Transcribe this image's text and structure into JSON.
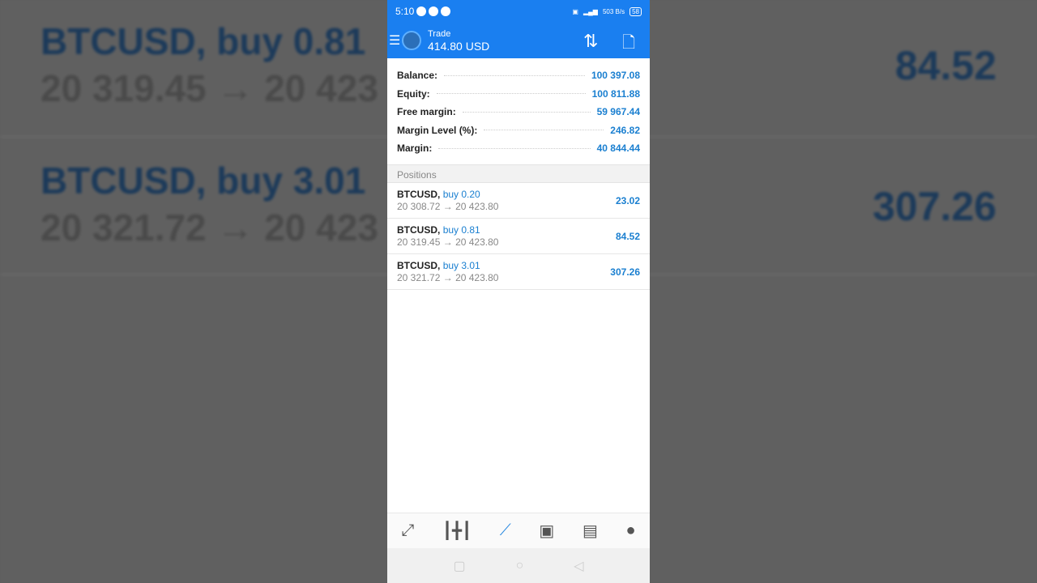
{
  "background_rows": [
    {
      "symbol": "BTCUSD,",
      "side": "buy 0.81",
      "prices": "20 319.45 → 20 423",
      "profit": "84.52"
    },
    {
      "symbol": "BTCUSD,",
      "side": "buy 3.01",
      "prices": "20 321.72 → 20 423",
      "profit": "307.26"
    }
  ],
  "status_bar": {
    "time": "5:10",
    "network": "503 B/s",
    "battery": "58"
  },
  "header": {
    "title": "Trade",
    "subtitle": "414.80 USD"
  },
  "account": [
    {
      "label": "Balance:",
      "value": "100 397.08"
    },
    {
      "label": "Equity:",
      "value": "100 811.88"
    },
    {
      "label": "Free margin:",
      "value": "59 967.44"
    },
    {
      "label": "Margin Level (%):",
      "value": "246.82"
    },
    {
      "label": "Margin:",
      "value": "40 844.44"
    }
  ],
  "positions_title": "Positions",
  "positions": [
    {
      "symbol": "BTCUSD,",
      "side": "buy 0.20",
      "open": "20 308.72",
      "current": "20 423.80",
      "profit": "23.02"
    },
    {
      "symbol": "BTCUSD,",
      "side": "buy 0.81",
      "open": "20 319.45",
      "current": "20 423.80",
      "profit": "84.52"
    },
    {
      "symbol": "BTCUSD,",
      "side": "buy 3.01",
      "open": "20 321.72",
      "current": "20 423.80",
      "profit": "307.26"
    }
  ],
  "nav": [
    "quotes-icon",
    "chart-icon",
    "trade-icon",
    "history-icon",
    "news-icon",
    "chat-icon"
  ],
  "accent": "#1a7ff0"
}
